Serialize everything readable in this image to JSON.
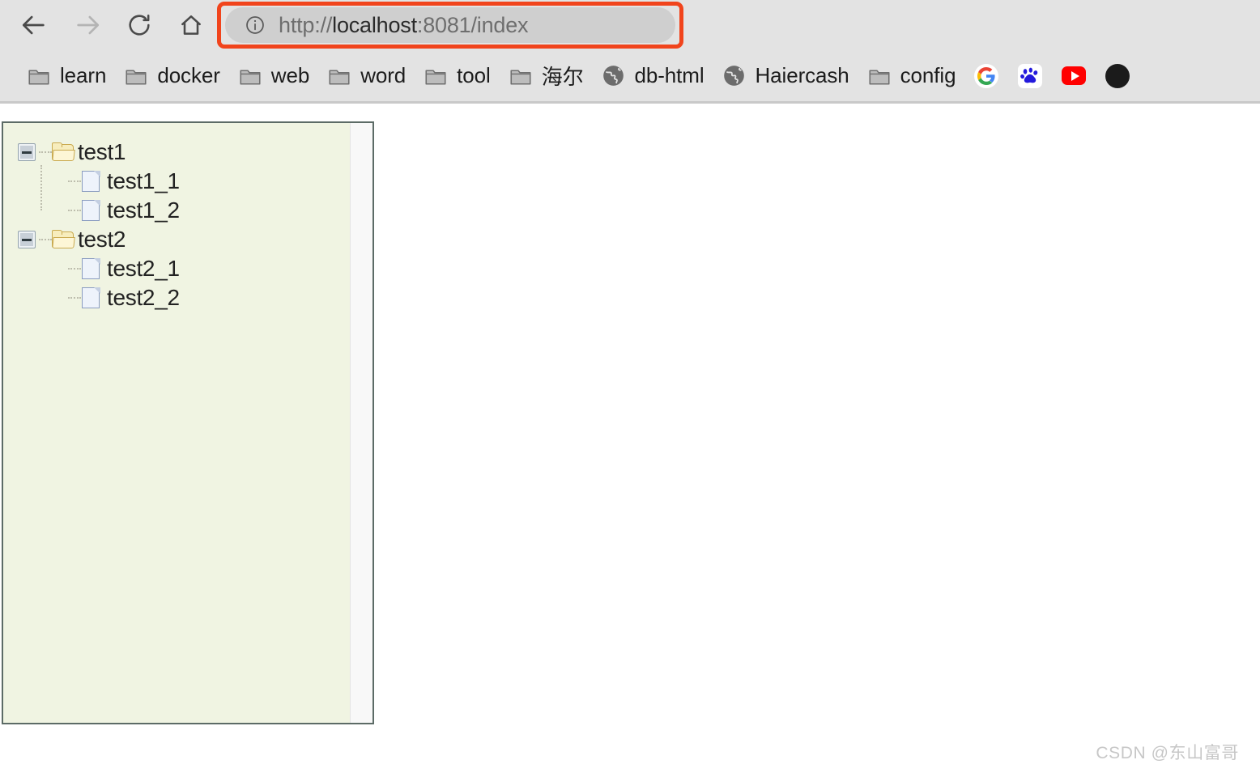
{
  "browser": {
    "nav": {
      "back_label": "Back",
      "forward_label": "Forward",
      "reload_label": "Reload",
      "home_label": "Home"
    },
    "address_bar": {
      "scheme": "http://",
      "host": "localhost",
      "rest": ":8081/index",
      "full_url": "http://localhost:8081/index",
      "info_icon": "info-circle-icon",
      "highlight_color": "#f1441c"
    },
    "bookmarks": [
      {
        "label": "learn",
        "icon": "folder-icon"
      },
      {
        "label": "docker",
        "icon": "folder-icon"
      },
      {
        "label": "web",
        "icon": "folder-icon"
      },
      {
        "label": "word",
        "icon": "folder-icon"
      },
      {
        "label": "tool",
        "icon": "folder-icon"
      },
      {
        "label": "海尔",
        "icon": "folder-icon"
      },
      {
        "label": "db-html",
        "icon": "globe-icon"
      },
      {
        "label": "Haiercash",
        "icon": "globe-icon"
      },
      {
        "label": "config",
        "icon": "folder-icon"
      },
      {
        "label": "",
        "icon": "google-icon"
      },
      {
        "label": "",
        "icon": "baidu-icon"
      },
      {
        "label": "",
        "icon": "youtube-icon"
      },
      {
        "label": "",
        "icon": "dark-circle-icon"
      }
    ]
  },
  "page": {
    "tree": {
      "nodes": [
        {
          "label": "test1",
          "type": "folder",
          "expanded": true,
          "children": [
            {
              "label": "test1_1",
              "type": "file"
            },
            {
              "label": "test1_2",
              "type": "file"
            }
          ]
        },
        {
          "label": "test2",
          "type": "folder",
          "expanded": true,
          "children": [
            {
              "label": "test2_1",
              "type": "file"
            },
            {
              "label": "test2_2",
              "type": "file"
            }
          ]
        }
      ]
    },
    "watermark": "CSDN @东山富哥"
  },
  "colors": {
    "chrome_bg": "#e3e3e3",
    "tree_bg": "#f0f4e2",
    "tree_border": "#5c6b66",
    "url_bar_bg": "#cfcfcf",
    "accent_red": "#f1441c"
  }
}
